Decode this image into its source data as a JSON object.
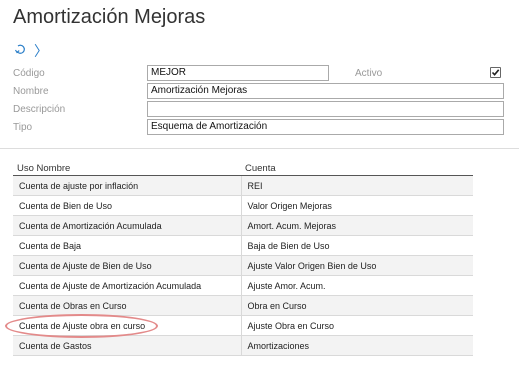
{
  "page": {
    "title": "Amortización Mejoras"
  },
  "nav": {
    "refresh_icon": "refresh-icon",
    "next_icon": "chevron-right-icon",
    "next_glyph": "〉"
  },
  "form": {
    "codigo_label": "Código",
    "codigo_value": "MEJOR",
    "activo_label": "Activo",
    "activo_checked": true,
    "nombre_label": "Nombre",
    "nombre_value": "Amortización Mejoras",
    "descripcion_label": "Descripción",
    "descripcion_value": "",
    "tipo_label": "Tipo",
    "tipo_value": "Esquema de Amortización"
  },
  "table": {
    "headers": [
      "Uso Nombre",
      "Cuenta"
    ],
    "rows": [
      [
        "Cuenta de ajuste por inflación",
        "REI"
      ],
      [
        "Cuenta de Bien de Uso",
        "Valor Origen Mejoras"
      ],
      [
        "Cuenta de Amortización Acumulada",
        "Amort. Acum. Mejoras"
      ],
      [
        "Cuenta de Baja",
        "Baja de Bien de Uso"
      ],
      [
        "Cuenta de Ajuste de Bien de Uso",
        "Ajuste Valor Origen Bien de Uso"
      ],
      [
        "Cuenta de Ajuste de Amortización Acumulada",
        "Ajuste Amor. Acum."
      ],
      [
        "Cuenta de Obras en Curso",
        "Obra en Curso"
      ],
      [
        "Cuenta de Ajuste obra en curso",
        "Ajuste Obra en Curso"
      ],
      [
        "Cuenta de Gastos",
        "Amortizaciones"
      ]
    ]
  },
  "colors": {
    "highlight": "#e38a8a",
    "accent": "#2a7ec8"
  }
}
